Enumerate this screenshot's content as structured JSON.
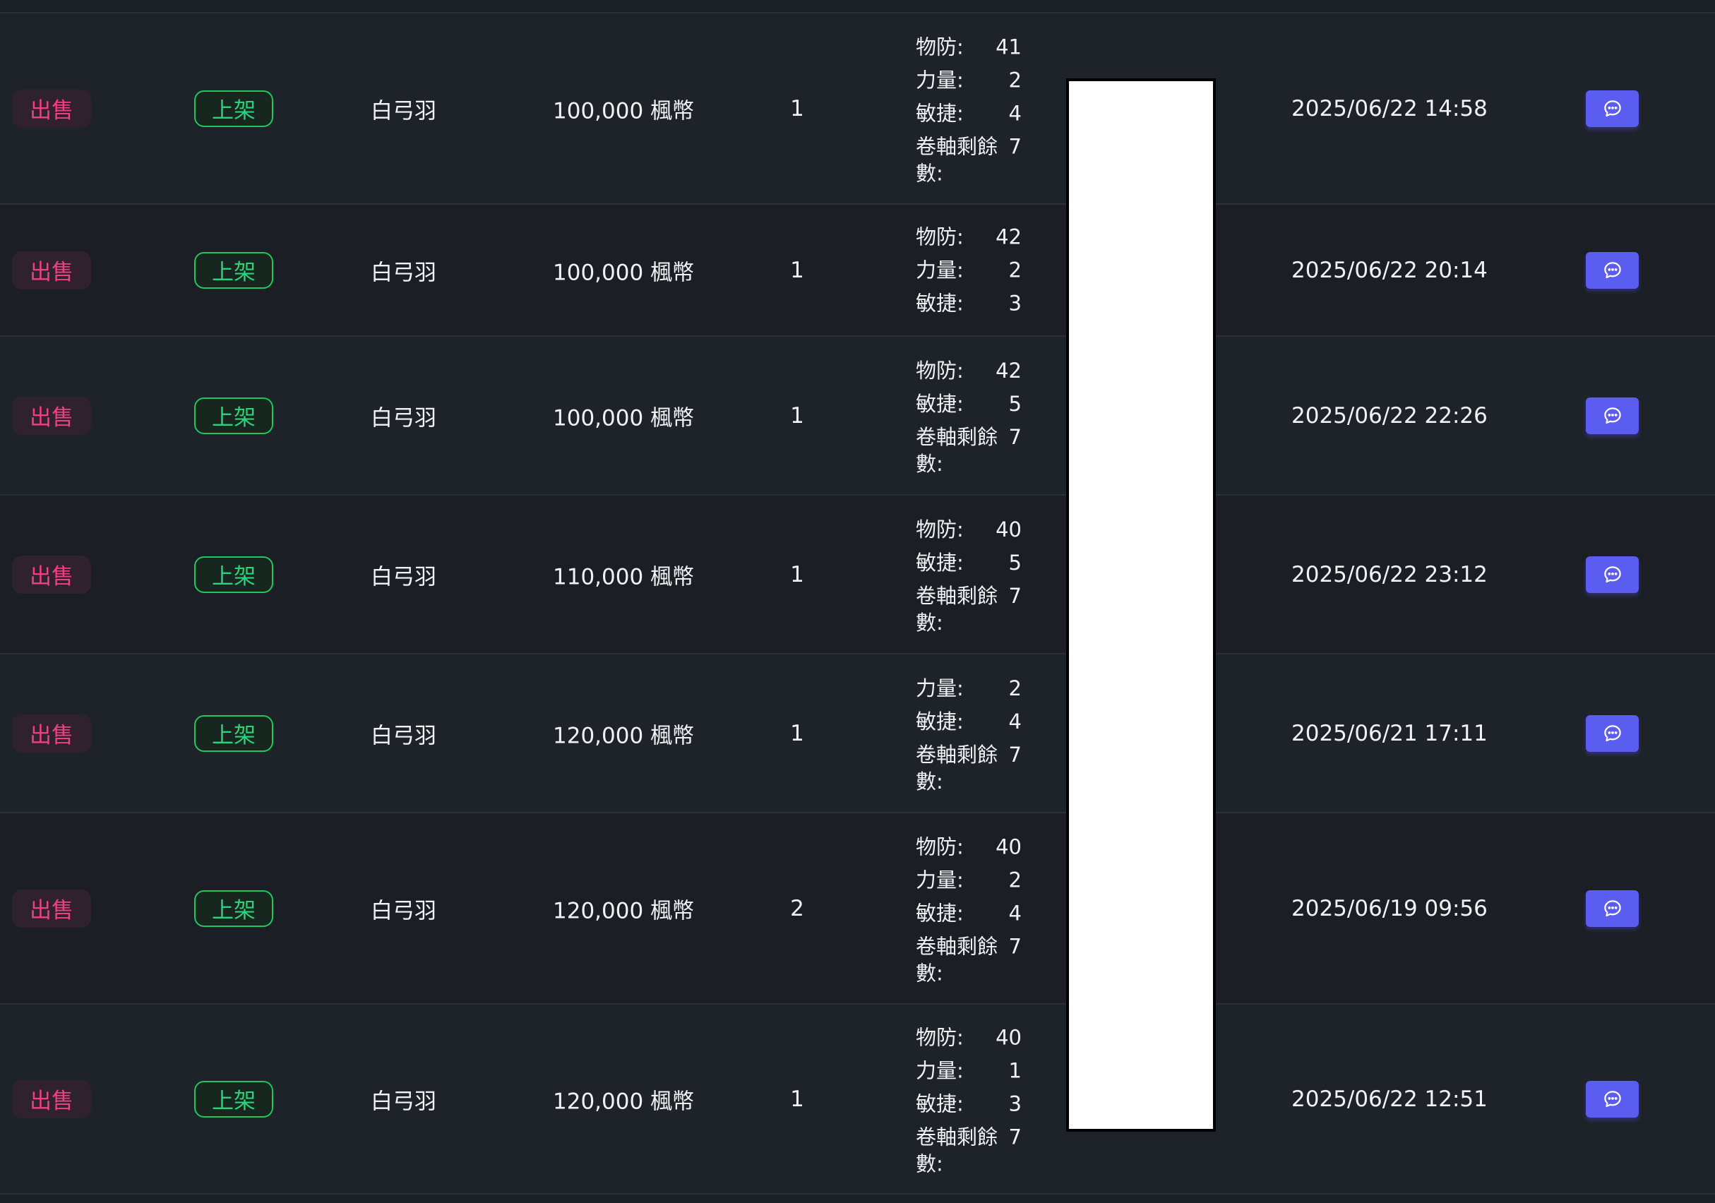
{
  "colors": {
    "background": "#1c2128",
    "type_text": "#ef3f86",
    "status_border": "#22c55e",
    "status_text": "#28d37a",
    "chat_button": "#5b5cf0",
    "redaction": "#ffffff"
  },
  "rows": [
    {
      "type": "出售",
      "status": "上架",
      "item": "白弓羽",
      "price": "100,000 楓幣",
      "qty": "1",
      "stats": [
        {
          "label": "物防:",
          "value": "41"
        },
        {
          "label": "力量:",
          "value": "2"
        },
        {
          "label": "敏捷:",
          "value": "4"
        },
        {
          "label": "卷軸剩餘數:",
          "value": "7"
        }
      ],
      "time": "2025/06/22 14:58",
      "chat_icon": "chat-bubble-icon"
    },
    {
      "type": "出售",
      "status": "上架",
      "item": "白弓羽",
      "price": "100,000 楓幣",
      "qty": "1",
      "stats": [
        {
          "label": "物防:",
          "value": "42"
        },
        {
          "label": "力量:",
          "value": "2"
        },
        {
          "label": "敏捷:",
          "value": "3"
        }
      ],
      "time": "2025/06/22 20:14",
      "chat_icon": "chat-bubble-icon"
    },
    {
      "type": "出售",
      "status": "上架",
      "item": "白弓羽",
      "price": "100,000 楓幣",
      "qty": "1",
      "stats": [
        {
          "label": "物防:",
          "value": "42"
        },
        {
          "label": "敏捷:",
          "value": "5"
        },
        {
          "label": "卷軸剩餘數:",
          "value": "7"
        }
      ],
      "time": "2025/06/22 22:26",
      "chat_icon": "chat-bubble-icon"
    },
    {
      "type": "出售",
      "status": "上架",
      "item": "白弓羽",
      "price": "110,000 楓幣",
      "qty": "1",
      "stats": [
        {
          "label": "物防:",
          "value": "40"
        },
        {
          "label": "敏捷:",
          "value": "5"
        },
        {
          "label": "卷軸剩餘數:",
          "value": "7"
        }
      ],
      "time": "2025/06/22 23:12",
      "chat_icon": "chat-bubble-icon"
    },
    {
      "type": "出售",
      "status": "上架",
      "item": "白弓羽",
      "price": "120,000 楓幣",
      "qty": "1",
      "stats": [
        {
          "label": "力量:",
          "value": "2"
        },
        {
          "label": "敏捷:",
          "value": "4"
        },
        {
          "label": "卷軸剩餘數:",
          "value": "7"
        }
      ],
      "time": "2025/06/21 17:11",
      "chat_icon": "chat-bubble-icon"
    },
    {
      "type": "出售",
      "status": "上架",
      "item": "白弓羽",
      "price": "120,000 楓幣",
      "qty": "2",
      "stats": [
        {
          "label": "物防:",
          "value": "40"
        },
        {
          "label": "力量:",
          "value": "2"
        },
        {
          "label": "敏捷:",
          "value": "4"
        },
        {
          "label": "卷軸剩餘數:",
          "value": "7"
        }
      ],
      "time": "2025/06/19 09:56",
      "chat_icon": "chat-bubble-icon"
    },
    {
      "type": "出售",
      "status": "上架",
      "item": "白弓羽",
      "price": "120,000 楓幣",
      "qty": "1",
      "stats": [
        {
          "label": "物防:",
          "value": "40"
        },
        {
          "label": "力量:",
          "value": "1"
        },
        {
          "label": "敏捷:",
          "value": "3"
        },
        {
          "label": "卷軸剩餘數:",
          "value": "7"
        }
      ],
      "time": "2025/06/22 12:51",
      "chat_icon": "chat-bubble-icon"
    }
  ]
}
